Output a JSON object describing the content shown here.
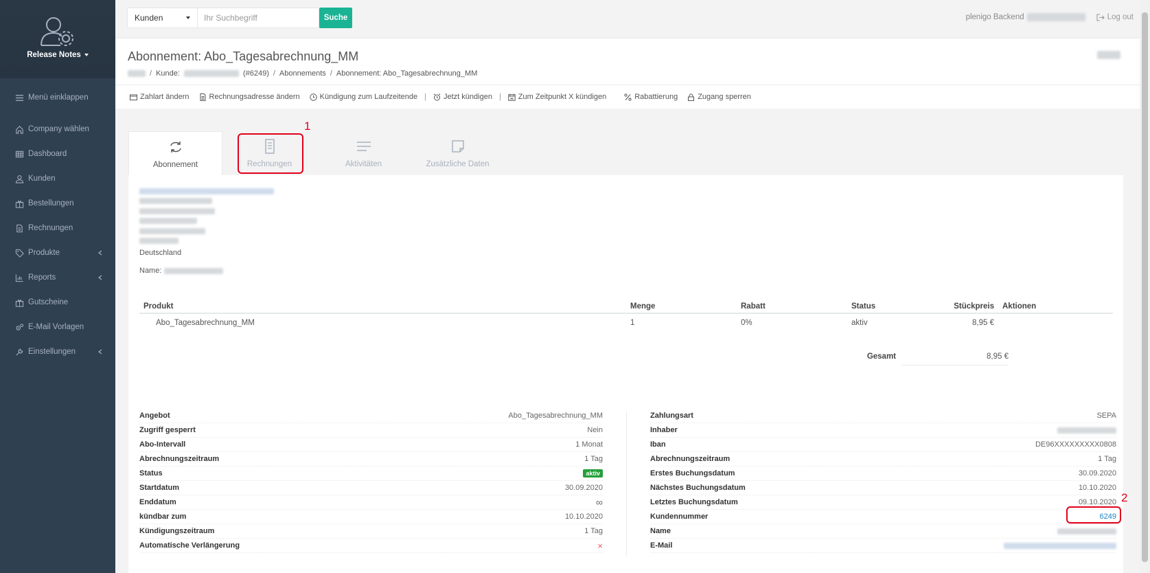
{
  "sidebar": {
    "brand": "Release Notes",
    "collapse_label": "Menü einklappen",
    "items": [
      {
        "label": "Company wählen",
        "icon": "home-icon"
      },
      {
        "label": "Dashboard",
        "icon": "table-icon"
      },
      {
        "label": "Kunden",
        "icon": "user-icon"
      },
      {
        "label": "Bestellungen",
        "icon": "gift-icon"
      },
      {
        "label": "Rechnungen",
        "icon": "file-icon"
      },
      {
        "label": "Produkte",
        "icon": "tag-icon"
      },
      {
        "label": "Reports",
        "icon": "chart-icon"
      },
      {
        "label": "Gutscheine",
        "icon": "gift-icon"
      },
      {
        "label": "E-Mail Vorlagen",
        "icon": "cogs-icon"
      },
      {
        "label": "Einstellungen",
        "icon": "wrench-icon"
      }
    ]
  },
  "topbar": {
    "search_type": "Kunden",
    "search_placeholder": "Ihr Suchbegriff",
    "search_button": "Suche",
    "backend_label": "plenigo Backend",
    "logout_label": "Log out"
  },
  "header": {
    "title": "Abonnement: Abo_Tagesabrechnung_MM",
    "breadcrumb": {
      "customer_prefix": "Kunde:",
      "customer_id": "(#6249)",
      "subscriptions": "Abonnements",
      "current": "Abonnement: Abo_Tagesabrechnung_MM"
    }
  },
  "actions": {
    "zahlart": "Zahlart ändern",
    "rechnungsadresse": "Rechnungsadresse ändern",
    "kuendigung_laufzeitende": "Kündigung zum Laufzeitende",
    "jetzt_kuendigen": "Jetzt kündigen",
    "zeitpunkt_kuendigen": "Zum Zeitpunkt X kündigen",
    "rabattierung": "Rabattierung",
    "zugang_sperren": "Zugang sperren"
  },
  "tabs": [
    {
      "label": "Abonnement"
    },
    {
      "label": "Rechnungen"
    },
    {
      "label": "Aktivitäten"
    },
    {
      "label": "Zusätzliche Daten"
    }
  ],
  "address": {
    "country": "Deutschland",
    "name_label": "Name:"
  },
  "products": {
    "headers": [
      "Produkt",
      "Menge",
      "Rabatt",
      "Status",
      "Stückpreis",
      "Aktionen"
    ],
    "rows": [
      {
        "produkt": "Abo_Tagesabrechnung_MM",
        "menge": "1",
        "rabatt": "0%",
        "status": "aktiv",
        "preis": "8,95 €"
      }
    ],
    "total_label": "Gesamt",
    "total_value": "8,95 €"
  },
  "details_left": {
    "rows": [
      {
        "k": "Angebot",
        "v": "Abo_Tagesabrechnung_MM"
      },
      {
        "k": "Zugriff gesperrt",
        "v": "Nein"
      },
      {
        "k": "Abo-Intervall",
        "v": "1 Monat"
      },
      {
        "k": "Abrechnungszeitraum",
        "v": "1 Tag"
      },
      {
        "k": "Status",
        "v": "aktiv"
      },
      {
        "k": "Startdatum",
        "v": "30.09.2020"
      },
      {
        "k": "Enddatum",
        "v": "∞"
      },
      {
        "k": "kündbar zum",
        "v": "10.10.2020"
      },
      {
        "k": "Kündigungszeitraum",
        "v": "1 Tag"
      },
      {
        "k": "Automatische Verlängerung",
        "v": "×"
      }
    ]
  },
  "details_right": {
    "rows": [
      {
        "k": "Zahlungsart",
        "v": "SEPA"
      },
      {
        "k": "Inhaber",
        "v": ""
      },
      {
        "k": "Iban",
        "v": "DE96XXXXXXXXX0808"
      },
      {
        "k": "Abrechnungszeitraum",
        "v": "1 Tag"
      },
      {
        "k": "Erstes Buchungsdatum",
        "v": "30.09.2020"
      },
      {
        "k": "Nächstes Buchungsdatum",
        "v": "10.10.2020"
      },
      {
        "k": "Letztes Buchungsdatum",
        "v": "09.10.2020"
      },
      {
        "k": "Kundennummer",
        "v": "6249"
      },
      {
        "k": "Name",
        "v": ""
      },
      {
        "k": "E-Mail",
        "v": ""
      }
    ]
  },
  "annotations": {
    "one": "1",
    "two": "2"
  },
  "colors": {
    "sidebar": "#2f4050",
    "accent": "#1ab394",
    "annotation": "#e2001a",
    "link": "#1c84c6"
  }
}
